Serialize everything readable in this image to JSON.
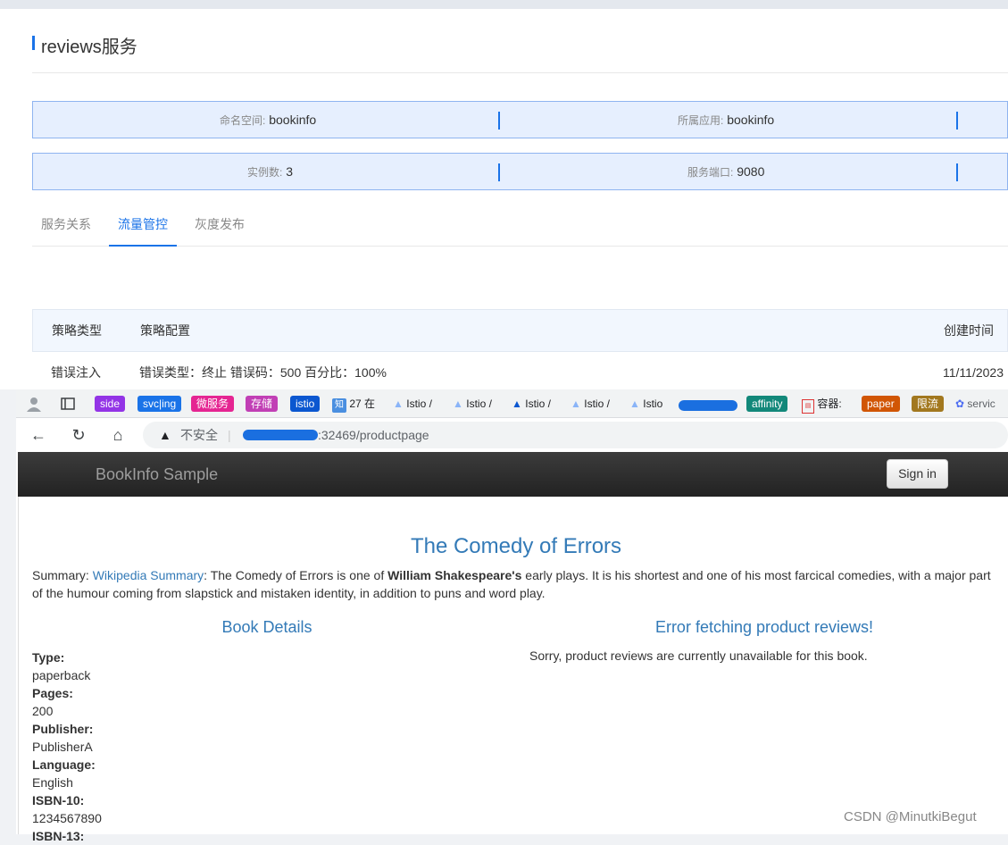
{
  "console": {
    "title": "reviews服务",
    "info": {
      "namespace_key": "命名空间:",
      "namespace_val": "bookinfo",
      "app_key": "所属应用:",
      "app_val": "bookinfo",
      "instances_key": "实例数:",
      "instances_val": "3",
      "port_key": "服务端口:",
      "port_val": "9080"
    },
    "tabs": [
      "服务关系",
      "流量管控",
      "灰度发布"
    ],
    "active_tab": "流量管控",
    "table": {
      "headers": [
        "策略类型",
        "策略配置",
        "创建时间"
      ],
      "rows": [
        [
          "错误注入",
          "错误类型：终止 错误码：500 百分比：100%",
          "11/11/2023"
        ]
      ]
    },
    "accent": "#1a73e8"
  },
  "browser": {
    "bookmarks": [
      {
        "label": "side",
        "color": "#9334e6"
      },
      {
        "label": "svc|ing",
        "color": "#1a73e8"
      },
      {
        "label": "微服务",
        "color": "#e52592"
      },
      {
        "label": "存储",
        "color": "#c13fb5"
      },
      {
        "label": "istio",
        "color": "#0b57d0"
      },
      {
        "label": "27 在",
        "color": ""
      },
      {
        "label": "Istio /",
        "color": ""
      },
      {
        "label": "Istio /",
        "color": ""
      },
      {
        "label": "Istio /",
        "color": ""
      },
      {
        "label": "Istio /",
        "color": ""
      },
      {
        "label": "Istio",
        "color": ""
      },
      {
        "label": "affinity",
        "color": "#12887a"
      },
      {
        "label": "容器:",
        "color": ""
      },
      {
        "label": "paper",
        "color": "#d15605"
      },
      {
        "label": "限流",
        "color": "#a2781f"
      },
      {
        "label": "servic",
        "color": ""
      }
    ],
    "security": "不安全",
    "url": ":32469/productpage"
  },
  "bookinfo": {
    "brand": "BookInfo Sample",
    "signin": "Sign in",
    "title": "The Comedy of Errors",
    "summary_label": "Summary:",
    "summary_link": "Wikipedia Summary",
    "summary_text1": ": The Comedy of Errors is one of ",
    "summary_bold": "William Shakespeare's",
    "summary_text2": " early plays. It is his shortest and one of his most farcical comedies, with a major part of the humour coming from slapstick and mistaken identity, in addition to puns and word play.",
    "details_heading": "Book Details",
    "reviews_heading": "Error fetching product reviews!",
    "reviews_error": "Sorry, product reviews are currently unavailable for this book.",
    "details": [
      {
        "k": "Type:",
        "v": "paperback"
      },
      {
        "k": "Pages:",
        "v": "200"
      },
      {
        "k": "Publisher:",
        "v": "PublisherA"
      },
      {
        "k": "Language:",
        "v": "English"
      },
      {
        "k": "ISBN-10:",
        "v": "1234567890"
      },
      {
        "k": "ISBN-13:",
        "v": ""
      }
    ]
  },
  "watermark": "CSDN @MinutkiBegut"
}
